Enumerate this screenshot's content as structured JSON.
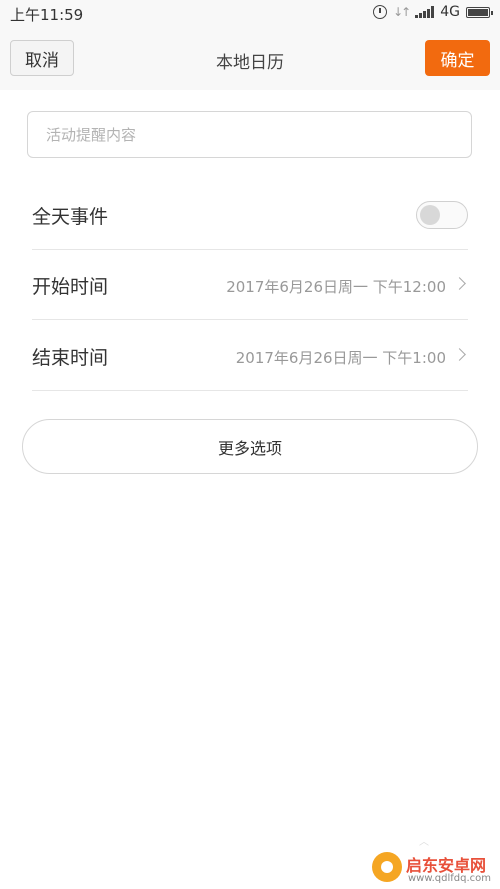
{
  "status_bar": {
    "time": "上午11:59",
    "network": "4G"
  },
  "header": {
    "cancel_label": "取消",
    "title": "本地日历",
    "confirm_label": "确定",
    "accent_color": "#f26a0f"
  },
  "form": {
    "content_placeholder": "活动提醒内容",
    "content_value": "",
    "all_day": {
      "label": "全天事件",
      "enabled": false
    },
    "start": {
      "label": "开始时间",
      "value": "2017年6月26日周一 下午12:00"
    },
    "end": {
      "label": "结束时间",
      "value": "2017年6月26日周一 下午1:00"
    },
    "more_options_label": "更多选项"
  },
  "watermark": {
    "name": "启东安卓网",
    "url": "www.qdlfdq.com"
  },
  "icons": {
    "status": [
      "alarm-icon",
      "data-arrows-icon",
      "signal-icon",
      "battery-icon"
    ],
    "row_chevron": "chevron-right-icon"
  }
}
